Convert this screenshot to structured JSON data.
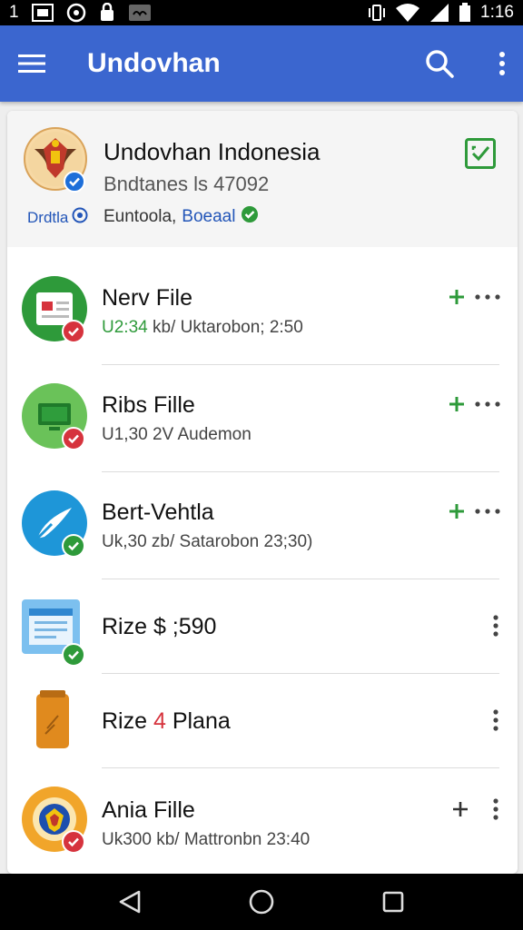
{
  "status_bar": {
    "left_text": "1",
    "time": "1:16",
    "icons": [
      "image-icon",
      "location-icon",
      "lock-icon",
      "voicemail-icon",
      "vibrate-icon",
      "wifi-icon",
      "signal-icon",
      "battery-icon"
    ]
  },
  "app_bar": {
    "title": "Undovhan",
    "icons": [
      "menu-icon",
      "search-icon",
      "more-vert-icon"
    ],
    "color": "#3b66cf"
  },
  "header": {
    "name": "Undovhan Indonesia",
    "subtitle": "Bndtanes ls 47092",
    "tag": "Drdtla",
    "location_prefix": "Euntoola,",
    "location_emph": "Boeaal"
  },
  "items": [
    {
      "name": "Nerv File",
      "meta_hl": "U2:34",
      "meta": " kb/ Uktarobon; 2:50",
      "status": "error",
      "actions": [
        "add",
        "more"
      ]
    },
    {
      "name": "Ribs Fille",
      "meta_hl": "",
      "meta": "U1,30 2V Audemon",
      "status": "error",
      "actions": [
        "add",
        "more"
      ]
    },
    {
      "name": "Bert-Vehtla",
      "meta_hl": "",
      "meta": "Uk,30 zb/ Satarobon 23;30)",
      "status": "ok",
      "actions": [
        "add",
        "more"
      ]
    },
    {
      "name": "Rize $ ;590",
      "meta_hl": "",
      "meta": "",
      "status": "ok",
      "actions": [
        "kebab"
      ]
    },
    {
      "name_prefix": "Rize ",
      "name_red": "4",
      "name_suffix": " Plana",
      "meta": "",
      "status": "none",
      "actions": [
        "kebab"
      ]
    },
    {
      "name": "Ania Fille",
      "meta_hl": "",
      "meta": "Uk300 kb/ Mattronbn 23:40",
      "status": "error",
      "actions": [
        "plus-dark",
        "kebab"
      ]
    }
  ],
  "colors": {
    "green": "#2e9a3a",
    "red": "#d6333d",
    "blue_link": "#2255b8"
  },
  "nav": [
    "back-icon",
    "home-icon",
    "recents-icon"
  ]
}
